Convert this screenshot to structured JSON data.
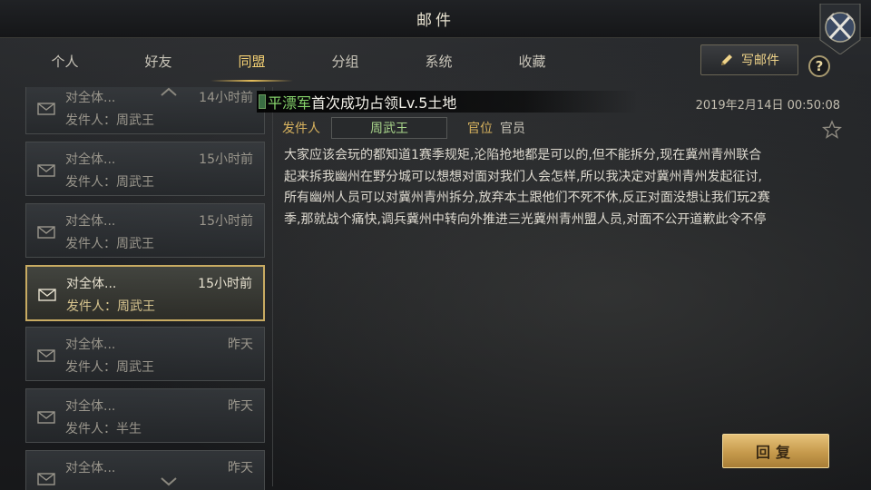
{
  "header": {
    "title": "邮件",
    "close_icon": "crossed-swords-close-icon"
  },
  "tabs": [
    {
      "label": "个人",
      "active": false
    },
    {
      "label": "好友",
      "active": false
    },
    {
      "label": "同盟",
      "active": true
    },
    {
      "label": "分组",
      "active": false
    },
    {
      "label": "系统",
      "active": false
    },
    {
      "label": "收藏",
      "active": false
    }
  ],
  "toolbar": {
    "compose_label": "写邮件",
    "help_label": "?"
  },
  "mail_list": [
    {
      "subject": "对全体...",
      "sender": "发件人：周武王",
      "time": "14小时前",
      "selected": false
    },
    {
      "subject": "对全体...",
      "sender": "发件人：周武王",
      "time": "15小时前",
      "selected": false
    },
    {
      "subject": "对全体...",
      "sender": "发件人：周武王",
      "time": "15小时前",
      "selected": false
    },
    {
      "subject": "对全体...",
      "sender": "发件人：周武王",
      "time": "15小时前",
      "selected": true
    },
    {
      "subject": "对全体...",
      "sender": "发件人：周武王",
      "time": "昨天",
      "selected": false
    },
    {
      "subject": "对全体...",
      "sender": "发件人：半生",
      "time": "昨天",
      "selected": false
    },
    {
      "subject": "对全体...",
      "sender": "",
      "time": "昨天",
      "selected": false
    }
  ],
  "detail": {
    "alliance_name": "平漂军",
    "subject": "首次成功占领Lv.5土地",
    "datetime": "2019年2月14日 00:50:08",
    "sender_label": "发件人",
    "sender_name": "周武王",
    "rank_label": "官位",
    "rank_value": "官员",
    "body_lines": [
      "大家应该会玩的都知道1赛季规矩,沦陷抢地都是可以的,但不能拆分,现在冀州青州联合",
      "起来拆我幽州在野分城可以想想对面对我们人会怎样,所以我决定对冀州青州发起征讨,",
      "所有幽州人员可以对冀州青州拆分,放弃本土跟他们不死不休,反正对面没想让我们玩2赛",
      "季,那就战个痛快,调兵冀州中转向外推进三光冀州青州盟人员,对面不公开道歉此令不停"
    ],
    "reply_label": "回复"
  },
  "colors": {
    "accent_gold": "#e6be5a",
    "alliance_green": "#86d46b",
    "selected_border": "#c8ab62"
  }
}
